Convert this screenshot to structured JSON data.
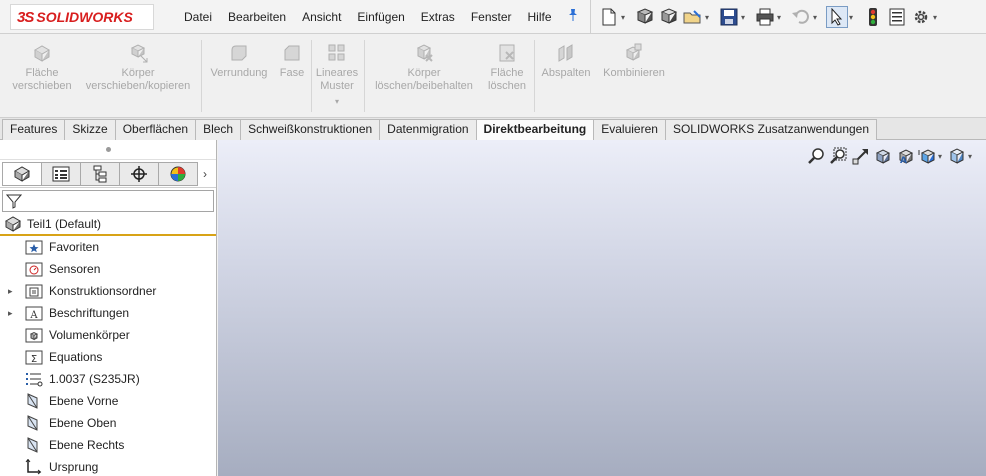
{
  "app": {
    "logo_prefix": "3S",
    "logo_name": "SOLIDWORKS"
  },
  "menu": {
    "items": [
      "Datei",
      "Bearbeiten",
      "Ansicht",
      "Einfügen",
      "Extras",
      "Fenster",
      "Hilfe"
    ]
  },
  "quick_access": {
    "buttons": [
      "new-document-icon",
      "open-options-icon",
      "open-file-icon",
      "open-folder-icon",
      "save-icon",
      "print-icon",
      "undo-icon",
      "select-icon",
      "rebuild-icon",
      "file-properties-icon",
      "options-icon"
    ]
  },
  "ribbon": {
    "commands": [
      {
        "line1": "Fläche",
        "line2": "verschieben",
        "icon": "move-face-icon"
      },
      {
        "line1": "Körper",
        "line2": "verschieben/kopieren",
        "icon": "move-copy-body-icon"
      },
      {
        "line1": "Verrundung",
        "line2": "",
        "icon": "fillet-icon"
      },
      {
        "line1": "Fase",
        "line2": "",
        "icon": "chamfer-icon"
      },
      {
        "line1": "Lineares",
        "line2": "Muster",
        "icon": "linear-pattern-icon"
      },
      {
        "line1": "Körper",
        "line2": "löschen/beibehalten",
        "icon": "delete-keep-body-icon"
      },
      {
        "line1": "Fläche",
        "line2": "löschen",
        "icon": "delete-face-icon"
      },
      {
        "line1": "Abspalten",
        "line2": "",
        "icon": "split-icon"
      },
      {
        "line1": "Kombinieren",
        "line2": "",
        "icon": "combine-icon"
      }
    ]
  },
  "tabs": {
    "items": [
      "Features",
      "Skizze",
      "Oberflächen",
      "Blech",
      "Schweißkonstruktionen",
      "Datenmigration",
      "Direktbearbeitung",
      "Evaluieren",
      "SOLIDWORKS Zusatzanwendungen"
    ],
    "active_index": 6
  },
  "feature_tree": {
    "root_label": "Teil1  (Default)",
    "items": [
      {
        "label": "Favoriten",
        "icon": "favorites-folder-icon",
        "expandable": false
      },
      {
        "label": "Sensoren",
        "icon": "sensors-folder-icon",
        "expandable": false
      },
      {
        "label": "Konstruktionsordner",
        "icon": "design-binder-icon",
        "expandable": true
      },
      {
        "label": "Beschriftungen",
        "icon": "annotations-icon",
        "expandable": true
      },
      {
        "label": "Volumenkörper",
        "icon": "solid-bodies-icon",
        "expandable": false
      },
      {
        "label": "Equations",
        "icon": "equations-icon",
        "expandable": false
      },
      {
        "label": "1.0037 (S235JR)",
        "icon": "material-icon",
        "expandable": false
      },
      {
        "label": "Ebene Vorne",
        "icon": "plane-icon",
        "expandable": false
      },
      {
        "label": "Ebene Oben",
        "icon": "plane-icon",
        "expandable": false
      },
      {
        "label": "Ebene Rechts",
        "icon": "plane-icon",
        "expandable": false
      },
      {
        "label": "Ursprung",
        "icon": "origin-icon",
        "expandable": false
      }
    ]
  },
  "colors": {
    "brand": "#d81e1e",
    "active_tab_underline": "#d8a317",
    "accent": "#2a6fd6"
  }
}
